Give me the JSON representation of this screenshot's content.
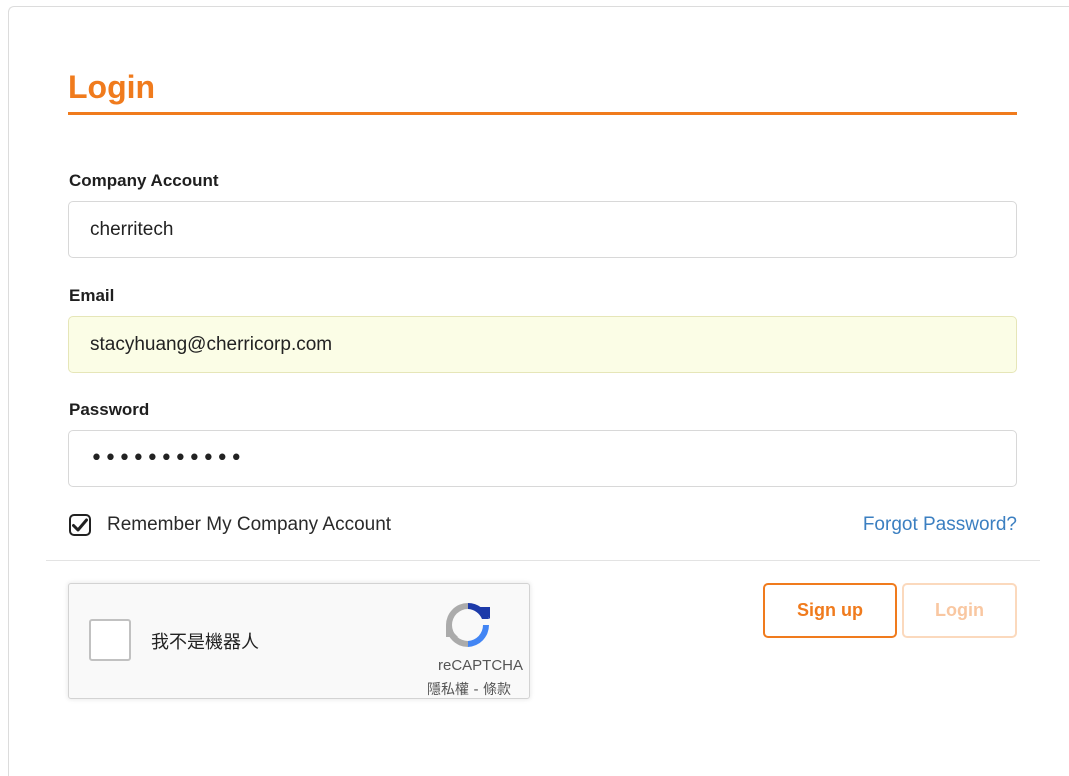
{
  "form": {
    "title": "Login",
    "company": {
      "label": "Company Account",
      "value": "cherritech"
    },
    "email": {
      "label": "Email",
      "value": "stacyhuang@cherricorp.com"
    },
    "password": {
      "label": "Password",
      "masked_value": "•••••••••••"
    },
    "remember": {
      "label": "Remember My Company Account",
      "checked": true
    },
    "forgot_label": "Forgot Password?"
  },
  "recaptcha": {
    "checkbox_text": "我不是機器人",
    "brand": "reCAPTCHA",
    "privacy_label": "隱私權",
    "separator": " - ",
    "terms_label": "條款"
  },
  "buttons": {
    "signup_label": "Sign up",
    "login_label": "Login"
  },
  "colors": {
    "accent": "#f07b1d",
    "link": "#3b7fc1",
    "autofill_bg": "#fbfde6",
    "login_disabled_text": "#f9c7a1"
  }
}
